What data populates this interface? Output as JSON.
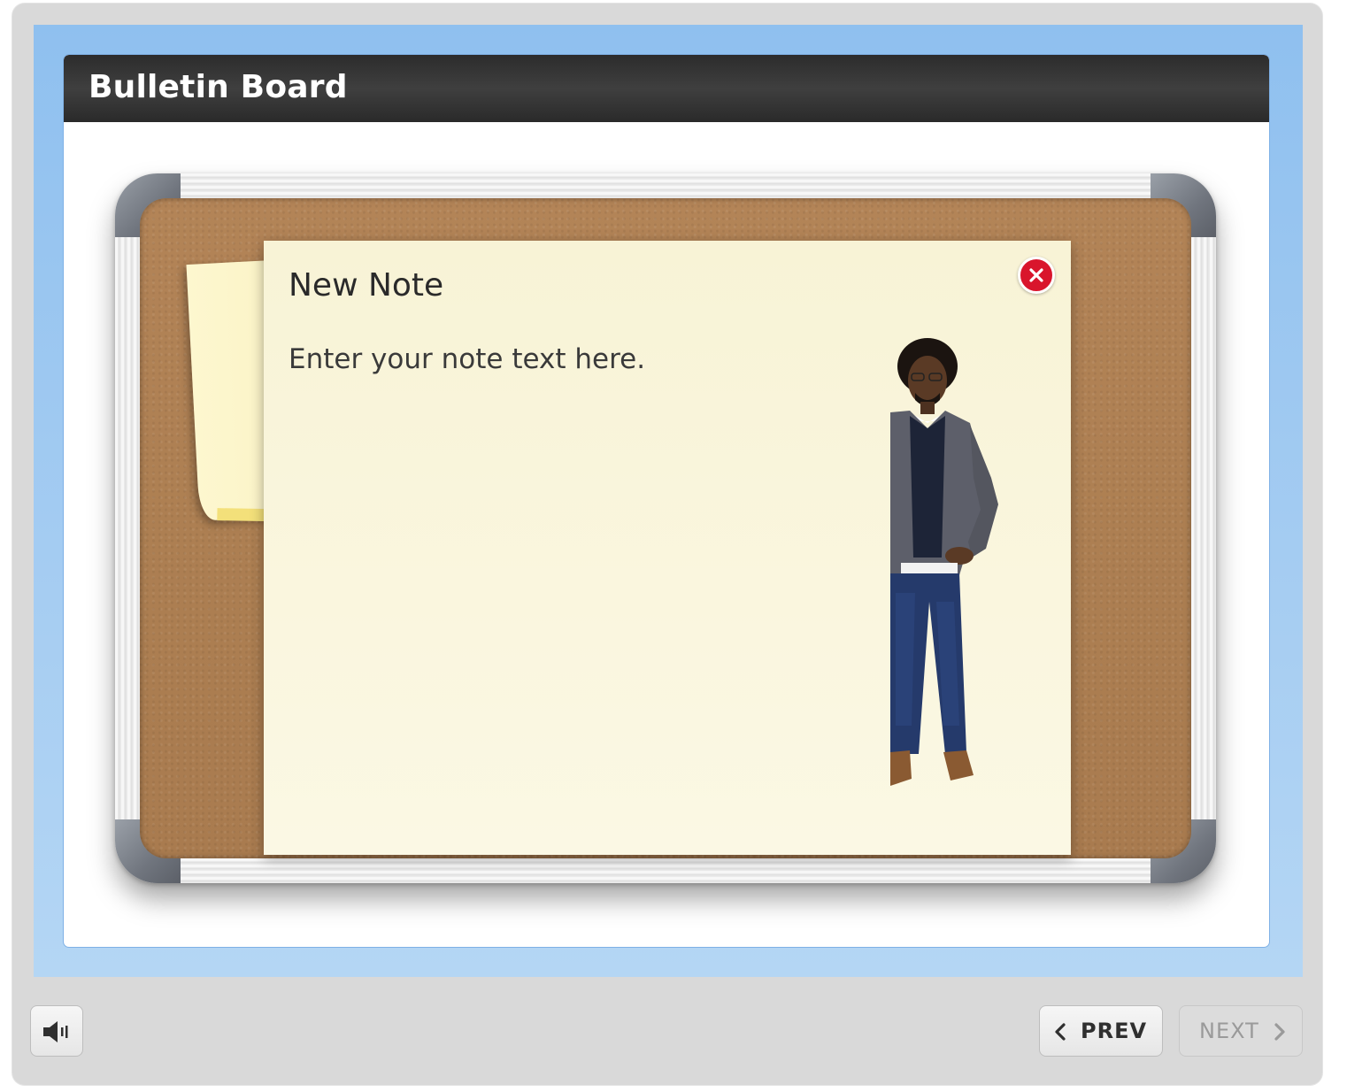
{
  "slide": {
    "title": "Bulletin Board"
  },
  "note": {
    "title": "New Note",
    "body": "Enter your note text here.",
    "close_icon": "close-icon",
    "close_color": "#d9152c"
  },
  "controls": {
    "volume_icon": "speaker-icon",
    "prev_label": "PREV",
    "next_label": "NEXT",
    "next_enabled": false
  },
  "colors": {
    "frame_blue": "#8fc0ef",
    "title_bar": "#333333",
    "cork": "#ad7f52",
    "note_bg": "#f8f3d6"
  }
}
